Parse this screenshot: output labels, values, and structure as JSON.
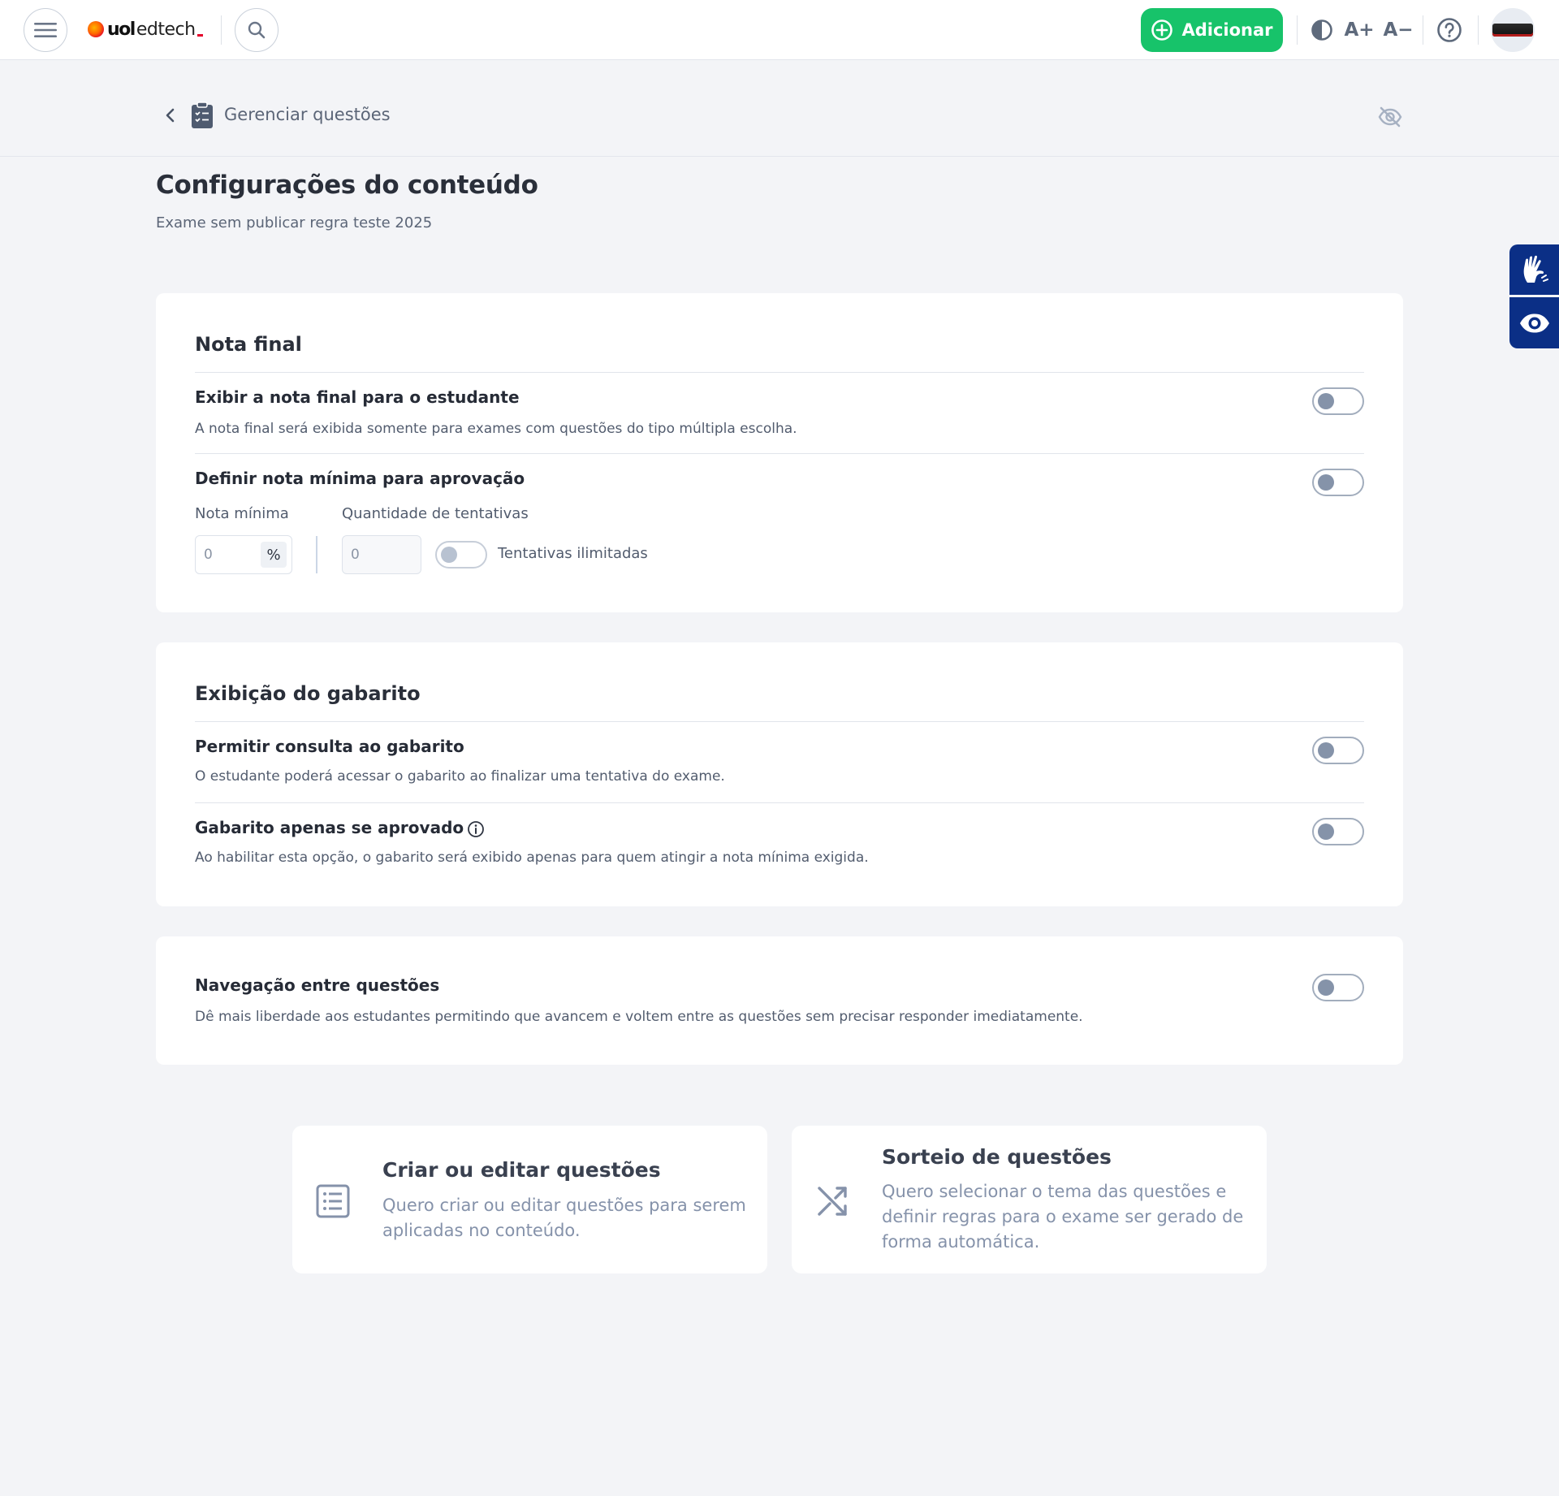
{
  "topbar": {
    "logo_uol": "uol",
    "logo_edtech": "edtech",
    "add_button_label": "Adicionar",
    "font_increase_label": "A+",
    "font_decrease_label": "A−"
  },
  "subheader": {
    "title": "Gerenciar questões"
  },
  "page": {
    "title": "Configurações do conteúdo",
    "subtitle": "Exame sem publicar regra teste 2025"
  },
  "nota_final": {
    "section_title": "Nota final",
    "show_grade": {
      "title": "Exibir a nota final para o estudante",
      "description": "A nota final será exibida somente para exames com questões do tipo múltipla escolha.",
      "enabled": false
    },
    "min_grade": {
      "title": "Definir nota mínima para aprovação",
      "enabled": false,
      "min_grade_label": "Nota mínima",
      "min_grade_value": "0",
      "min_grade_suffix": "%",
      "attempts_label": "Quantidade de tentativas",
      "attempts_value": "0",
      "unlimited_label": "Tentativas ilimitadas",
      "unlimited_enabled": false
    }
  },
  "gabarito": {
    "section_title": "Exibição do gabarito",
    "allow_consult": {
      "title": "Permitir consulta ao gabarito",
      "description": "O estudante poderá acessar o gabarito ao finalizar uma tentativa do exame.",
      "enabled": false
    },
    "only_approved": {
      "title": "Gabarito apenas se aprovado",
      "description": "Ao habilitar esta opção, o gabarito será exibido apenas para quem atingir a nota mínima exigida.",
      "enabled": false
    }
  },
  "navegacao": {
    "title": "Navegação entre questões",
    "description": "Dê mais liberdade aos estudantes permitindo que avancem e voltem entre as questões sem precisar responder imediatamente.",
    "enabled": false
  },
  "actions": {
    "create": {
      "title": "Criar ou editar questões",
      "description": "Quero criar ou editar questões para serem aplicadas no conteúdo."
    },
    "draw": {
      "title": "Sorteio de questões",
      "description": "Quero selecionar o tema das questões e definir regras para o exame ser gerado de forma automática."
    }
  },
  "icons": {
    "menu": "hamburger-icon",
    "search": "search-icon",
    "add": "plus-circle-icon",
    "contrast": "contrast-icon",
    "help": "help-icon",
    "back": "chevron-left-icon",
    "clipboard": "clipboard-icon",
    "visibility": "eye-off-icon",
    "sign_language": "sign-language-icon",
    "accessibility_view": "eye-icon",
    "info": "info-icon",
    "list": "list-icon",
    "shuffle": "shuffle-icon"
  },
  "colors": {
    "primary_green": "#17c36a",
    "accessibility_blue": "#0b2f86",
    "background": "#f3f4f7"
  }
}
